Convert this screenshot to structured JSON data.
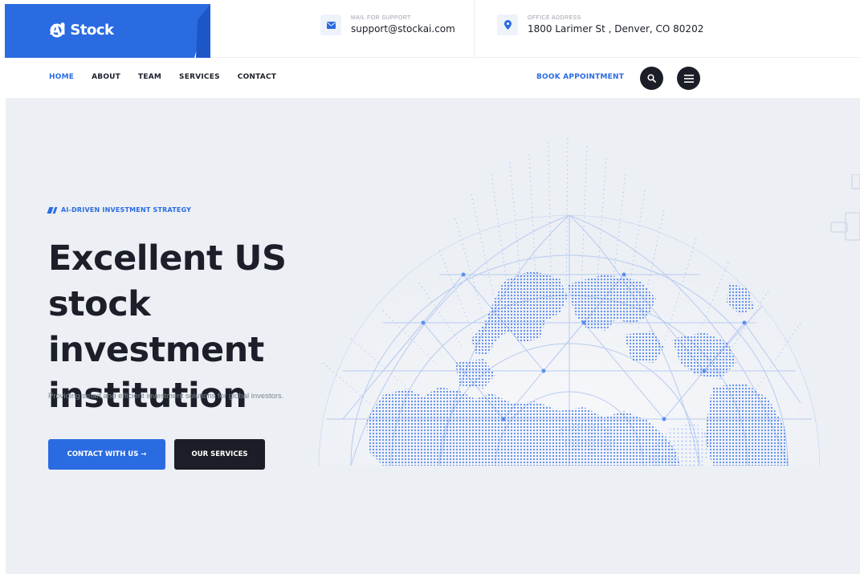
{
  "brand": {
    "name": "AI Stock",
    "color": "#2a6be2",
    "dark": "#1b1e26"
  },
  "contact": {
    "mail": {
      "label": "MAIL FOR SUPPORT",
      "value": "support@stockai.com",
      "icon": "envelope-icon"
    },
    "office": {
      "label": "OFFICE ADDRESS",
      "value": "1800 Larimer St , Denver, CO 80202",
      "icon": "map-pin-icon"
    }
  },
  "nav": {
    "items": [
      {
        "label": "HOME",
        "active": true
      },
      {
        "label": "ABOUT"
      },
      {
        "label": "TEAM"
      },
      {
        "label": "SERVICES"
      },
      {
        "label": "CONTACT"
      }
    ],
    "book": "BOOK APPOINTMENT",
    "search_icon": "search-icon",
    "menu_icon": "menu-icon"
  },
  "hero": {
    "tag": "AI-DRIVEN INVESTMENT STRATEGY",
    "headline": [
      "Excellent US stock",
      "investment",
      "institution"
    ],
    "subtext": "Providing smart and efficient investment solutions for global investors.",
    "primary_button": "CONTACT WITH US →",
    "secondary_button": "OUR SERVICES",
    "background": "#eceff4"
  }
}
